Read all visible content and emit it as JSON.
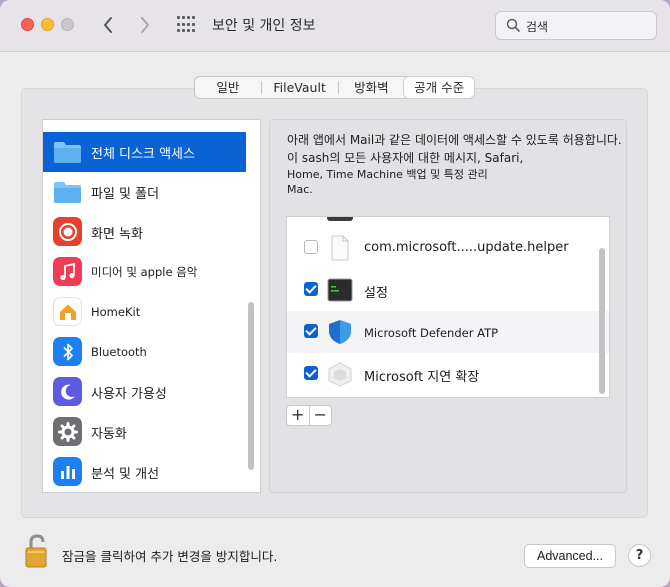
{
  "window": {
    "title": "보안 및 개인 정보",
    "search_placeholder": "검색"
  },
  "tabs": [
    {
      "label": "일반"
    },
    {
      "label": "FileVault"
    },
    {
      "label": "방화벽"
    },
    {
      "label": "공개 수준",
      "selected": true
    }
  ],
  "sidebar": {
    "items": [
      {
        "label": "전체 디스크 액세스",
        "icon": "folder-icon",
        "selected": true
      },
      {
        "label": "파일 및 폴더",
        "icon": "folder-icon"
      },
      {
        "label": "화면 녹화",
        "icon": "screen-recording-icon"
      },
      {
        "label": "미디어 및 apple 음악",
        "icon": "music-icon"
      },
      {
        "label": "HomeKit",
        "icon": "home-icon"
      },
      {
        "label": "Bluetooth",
        "icon": "bluetooth-icon"
      },
      {
        "label": "사용자 가용성",
        "icon": "moon-icon"
      },
      {
        "label": "자동화",
        "icon": "gear-icon"
      },
      {
        "label": "분석 및 개선",
        "icon": "chart-icon"
      }
    ]
  },
  "description": {
    "line1": "아래 앱에서 Mail과 같은 데이터에 액세스할 수 있도록 허용합니다.",
    "line2": "이 sash의 모든 사용자에 대한 메시지, Safari,",
    "line3": "Home, Time Machine 백업 및 특정 관리",
    "line4": "Mac."
  },
  "apps": [
    {
      "name": "com.microsoft.....update.helper",
      "checked": false,
      "icon": "document-icon"
    },
    {
      "name": "설정",
      "checked": true,
      "icon": "terminal-icon"
    },
    {
      "name": "Microsoft Defender ATP",
      "checked": true,
      "icon": "shield-icon"
    },
    {
      "name": "Microsoft 지연 확장",
      "checked": true,
      "icon": "extension-icon"
    }
  ],
  "controls": {
    "add_label": "+",
    "remove_label": "−"
  },
  "footer": {
    "lock_text": "잠금을 클릭하여 추가 변경을 방지합니다.",
    "advanced_label": "Advanced...",
    "help_label": "?"
  },
  "colors": {
    "accent": "#0a63d4"
  }
}
